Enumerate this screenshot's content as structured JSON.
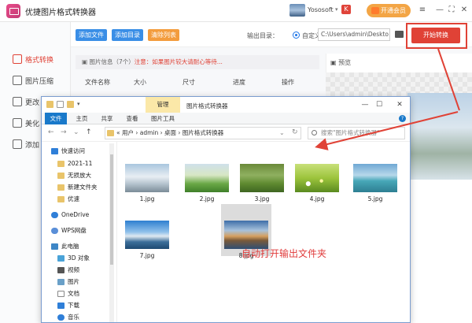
{
  "app": {
    "title": "优捷图片格式转换器",
    "user_name": "Yososoft",
    "user_caret": "▾",
    "vip_badge": "K",
    "vip_label": "开通会员",
    "ctrl_menu": "≡",
    "ctrl_min": "—",
    "ctrl_max": "⛶",
    "ctrl_close": "✕"
  },
  "sidebar": {
    "items": [
      {
        "label": "格式转换"
      },
      {
        "label": "图片压缩"
      },
      {
        "label": "更改"
      },
      {
        "label": "美化"
      },
      {
        "label": "添加"
      }
    ]
  },
  "toolbar": {
    "add_file": "添加文件",
    "add_dir": "添加目录",
    "clear_list": "清除列表",
    "output_label": "输出目录：",
    "custom_label": "自定义",
    "output_path": "C:\\Users\\admin\\Deskto",
    "start_label": "开始转换"
  },
  "list": {
    "info_prefix": "图片信息（7个）",
    "info_warning": "注意：如果图片较大请耐心等待...",
    "columns": [
      "文件名称",
      "大小",
      "尺寸",
      "进度",
      "操作"
    ]
  },
  "preview": {
    "title": "预览"
  },
  "explorer": {
    "context_tab": "管理",
    "window_title": "图片格式转换器",
    "ctrl_min": "—",
    "ctrl_max": "☐",
    "ctrl_close": "✕",
    "tabs": [
      "文件",
      "主页",
      "共享",
      "查看",
      "图片工具"
    ],
    "help": "?",
    "nav_back": "←",
    "nav_forward": "→",
    "nav_down": "⌄",
    "nav_up": "↑",
    "address": "«  用户  ›  admin  ›  桌面  ›  图片格式转换器",
    "address_caret": "⌄",
    "refresh": "↻",
    "search_placeholder": "搜索\"图片格式转换器\"",
    "tree": [
      {
        "label": "快速访问",
        "icon": "star-icon"
      },
      {
        "label": "2021-11",
        "icon": "folder-icon"
      },
      {
        "label": "无损放大",
        "icon": "folder-icon"
      },
      {
        "label": "新建文件夹",
        "icon": "folder-icon"
      },
      {
        "label": "优速",
        "icon": "folder-icon"
      },
      {
        "label": "OneDrive",
        "icon": "cloud-icon"
      },
      {
        "label": "WPS网盘",
        "icon": "cloud-icon"
      },
      {
        "label": "此电脑",
        "icon": "computer-icon"
      },
      {
        "label": "3D 对象",
        "icon": "cube-icon"
      },
      {
        "label": "视频",
        "icon": "video-icon"
      },
      {
        "label": "图片",
        "icon": "image-icon"
      },
      {
        "label": "文档",
        "icon": "document-icon"
      },
      {
        "label": "下载",
        "icon": "download-icon"
      },
      {
        "label": "音乐",
        "icon": "music-icon"
      }
    ],
    "files": [
      {
        "name": "1.jpg"
      },
      {
        "name": "2.jpg"
      },
      {
        "name": "3.jpg"
      },
      {
        "name": "4.jpg"
      },
      {
        "name": "5.jpg"
      },
      {
        "name": "7.jpg"
      },
      {
        "name": "8.jpg"
      }
    ]
  },
  "annotation": {
    "text": "自动打开输出文件夹"
  },
  "colors": {
    "accent_red": "#e04236",
    "blue_button": "#3a8ee6",
    "orange_button": "#f39c3d",
    "explorer_blue": "#1979ca"
  }
}
